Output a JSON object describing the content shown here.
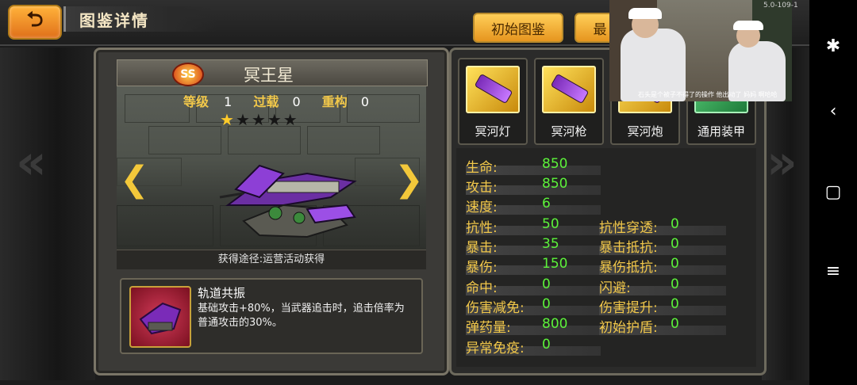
{
  "header": {
    "title": "图鉴详情",
    "tabs": [
      {
        "label": "初始图鉴"
      },
      {
        "label": "最"
      }
    ]
  },
  "unit": {
    "rank": "SS",
    "name": "冥王星",
    "level_label": "等级",
    "level": "1",
    "overload_label": "过载",
    "overload": "0",
    "rebuild_label": "重构",
    "rebuild": "0",
    "stars_filled": 1,
    "stars_total": 5,
    "source": "获得途径:运营活动获得"
  },
  "skill": {
    "title": "轨道共振",
    "description": "基础攻击+80%，当武器追击时，追击倍率为普通攻击的30%。"
  },
  "weapons": [
    {
      "label": "冥河灯"
    },
    {
      "label": "冥河枪"
    },
    {
      "label": "冥河炮"
    },
    {
      "label": "通用装甲"
    }
  ],
  "stats_left": [
    {
      "label": "生命:",
      "value": "850"
    },
    {
      "label": "攻击:",
      "value": "850"
    },
    {
      "label": "速度:",
      "value": "6"
    },
    {
      "label": "抗性:",
      "value": "50"
    },
    {
      "label": "暴击:",
      "value": "35"
    },
    {
      "label": "暴伤:",
      "value": "150"
    },
    {
      "label": "命中:",
      "value": "0"
    },
    {
      "label": "伤害减免:",
      "value": "0"
    },
    {
      "label": "弹药量:",
      "value": "800"
    },
    {
      "label": "异常免疫:",
      "value": "0"
    }
  ],
  "stats_right": [
    {
      "label": "抗性穿透:",
      "value": "0"
    },
    {
      "label": "暴击抵抗:",
      "value": "0"
    },
    {
      "label": "暴伤抵抗:",
      "value": "0"
    },
    {
      "label": "闪避:",
      "value": "0"
    },
    {
      "label": "伤害提升:",
      "value": "0"
    },
    {
      "label": "初始护盾:",
      "value": "0"
    }
  ],
  "video_overlay": {
    "caption": "石头是个被子不得了的操作 他出动了 妈妈 啊哈哈",
    "corner_text": "5.0-109-1"
  },
  "colors": {
    "stat_label": "#f2c84a",
    "stat_value": "#5cf23a",
    "tab_gold": "#e6951f",
    "back_orange": "#e0701a"
  },
  "icons": {
    "back": "back-arrow-icon",
    "prev": "chevron-left-icon",
    "next": "chevron-right-icon",
    "accessibility": "accessibility-icon",
    "nav_back": "nav-back-icon",
    "nav_home": "nav-home-icon",
    "nav_menu": "nav-menu-icon"
  }
}
